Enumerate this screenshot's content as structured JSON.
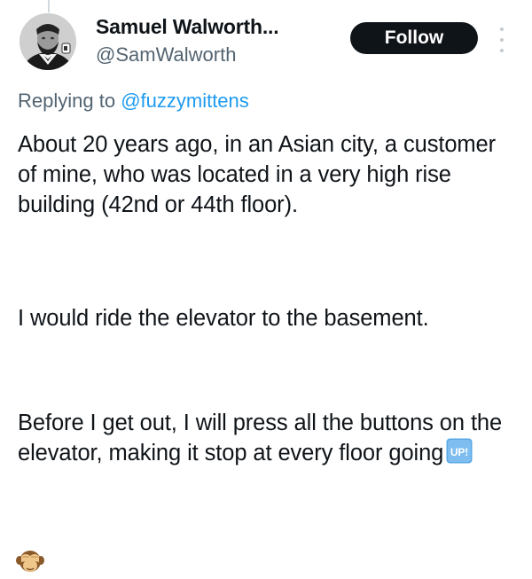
{
  "author": {
    "display_name": "Samuel Walworth...",
    "handle": "@SamWalworth"
  },
  "follow_label": "Follow",
  "reply_context": {
    "prefix": "Replying to ",
    "mention": "@fuzzymittens"
  },
  "tweet": {
    "paragraphs": [
      "About 20 years ago, in an Asian city, a customer of mine, who was located in a very high rise building (42nd or 44th floor).",
      "I would ride the elevator to the basement.",
      "Before I get out, I will press all the buttons on the elevator, making it stop at every floor going"
    ],
    "up_emoji_label": "UP!",
    "final_emoji": "see-no-evil-monkey-emoji"
  },
  "icons": {
    "more": "more-options-icon",
    "avatar": "avatar-portrait"
  },
  "colors": {
    "follow_bg": "#0f1419",
    "link": "#1d9bf0",
    "secondary_text": "#536471",
    "up_badge": "#5aa9e6"
  }
}
